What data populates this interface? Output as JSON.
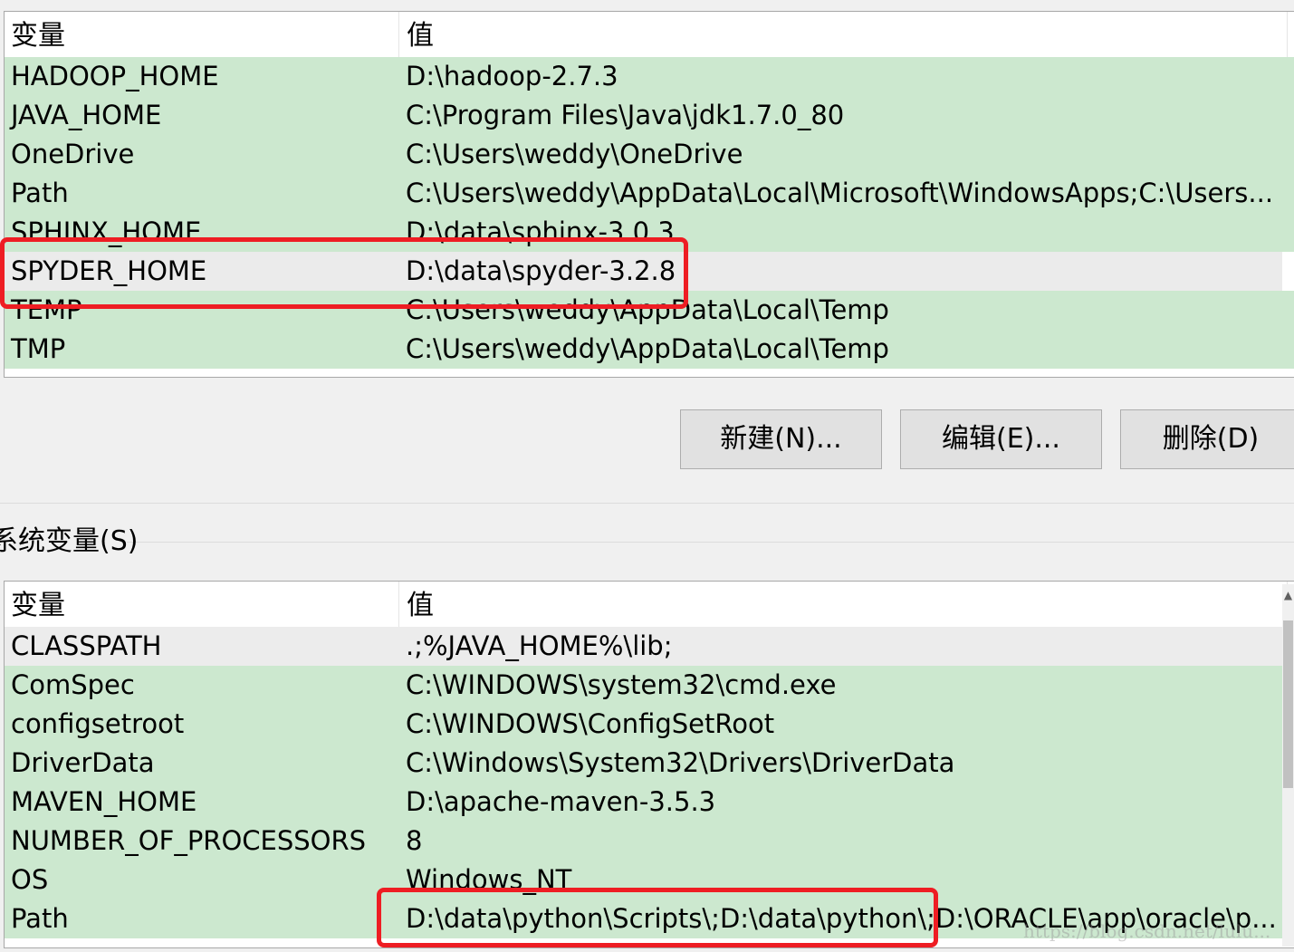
{
  "user_vars": {
    "header": {
      "col_name": "变量",
      "col_value": "值"
    },
    "rows": [
      {
        "name": "HADOOP_HOME",
        "value": "D:\\hadoop-2.7.3"
      },
      {
        "name": "JAVA_HOME",
        "value": "C:\\Program Files\\Java\\jdk1.7.0_80"
      },
      {
        "name": "OneDrive",
        "value": "C:\\Users\\weddy\\OneDrive"
      },
      {
        "name": "Path",
        "value": "C:\\Users\\weddy\\AppData\\Local\\Microsoft\\WindowsApps;C:\\Users..."
      },
      {
        "name": "SPHINX_HOME",
        "value": "D:\\data\\sphinx-3.0.3"
      },
      {
        "name": "SPYDER_HOME",
        "value": "D:\\data\\spyder-3.2.8"
      },
      {
        "name": "TEMP",
        "value": "C:\\Users\\weddy\\AppData\\Local\\Temp"
      },
      {
        "name": "TMP",
        "value": "C:\\Users\\weddy\\AppData\\Local\\Temp"
      }
    ]
  },
  "buttons": {
    "new": "新建(N)...",
    "edit": "编辑(E)...",
    "delete": "删除(D)"
  },
  "system_vars": {
    "group_title": "系统变量(S)",
    "header": {
      "col_name": "变量",
      "col_value": "值"
    },
    "rows": [
      {
        "name": "CLASSPATH",
        "value": ".;%JAVA_HOME%\\lib;"
      },
      {
        "name": "ComSpec",
        "value": "C:\\WINDOWS\\system32\\cmd.exe"
      },
      {
        "name": "configsetroot",
        "value": "C:\\WINDOWS\\ConfigSetRoot"
      },
      {
        "name": "DriverData",
        "value": "C:\\Windows\\System32\\Drivers\\DriverData"
      },
      {
        "name": "MAVEN_HOME",
        "value": "D:\\apache-maven-3.5.3"
      },
      {
        "name": "NUMBER_OF_PROCESSORS",
        "value": "8"
      },
      {
        "name": "OS",
        "value": "Windows_NT"
      },
      {
        "name": "Path",
        "value": "D:\\data\\python\\Scripts\\;D:\\data\\python\\;D:\\ORACLE\\app\\oracle\\p..."
      }
    ]
  },
  "watermark": "https://blog.csdn.net/lulu..."
}
